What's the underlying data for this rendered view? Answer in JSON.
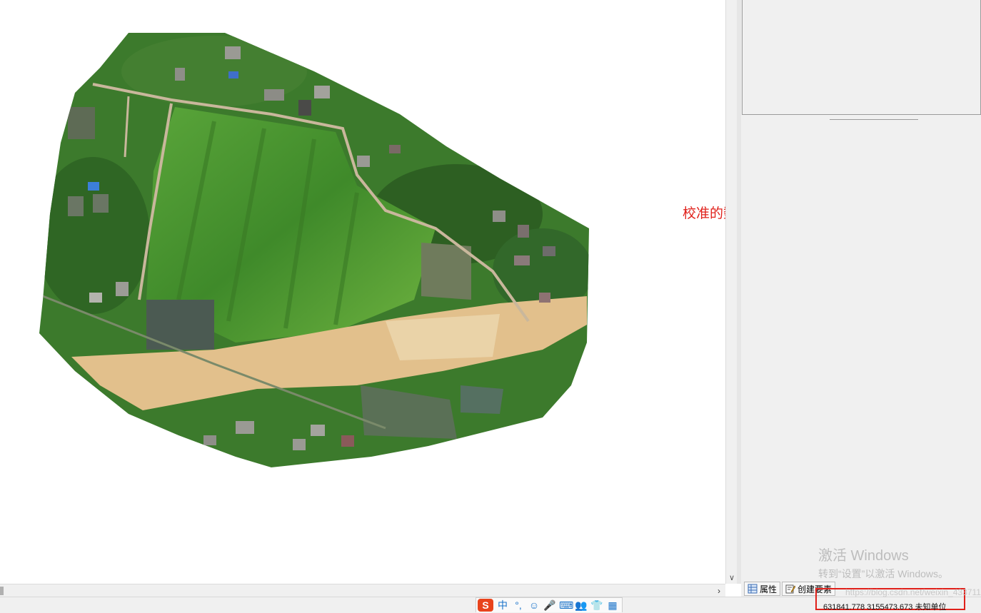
{
  "map": {
    "annotation_text": "校准的数据"
  },
  "right_panel": {
    "watermark_line1": "激活 Windows",
    "watermark_line2": "转到“设置”以激活 Windows。",
    "tabs": [
      {
        "label": "属性",
        "icon": "table-icon"
      },
      {
        "label": "创建要素",
        "icon": "edit-form-icon"
      }
    ]
  },
  "status_bar": {
    "coordinates": "631841.778  3155473.673 未知单位",
    "faded_url": "https://blog.csdn.net/weixin_43371136",
    "ime": {
      "logo": "S",
      "items": [
        "中",
        "°,",
        "☺",
        "🎤",
        "⌨",
        "👥",
        "👕",
        "▦"
      ]
    }
  },
  "colors": {
    "annotation": "#e0201a",
    "highlight_box": "#e0201a",
    "field_green": "#4f9a2e",
    "road_sand": "#e2c08c"
  }
}
